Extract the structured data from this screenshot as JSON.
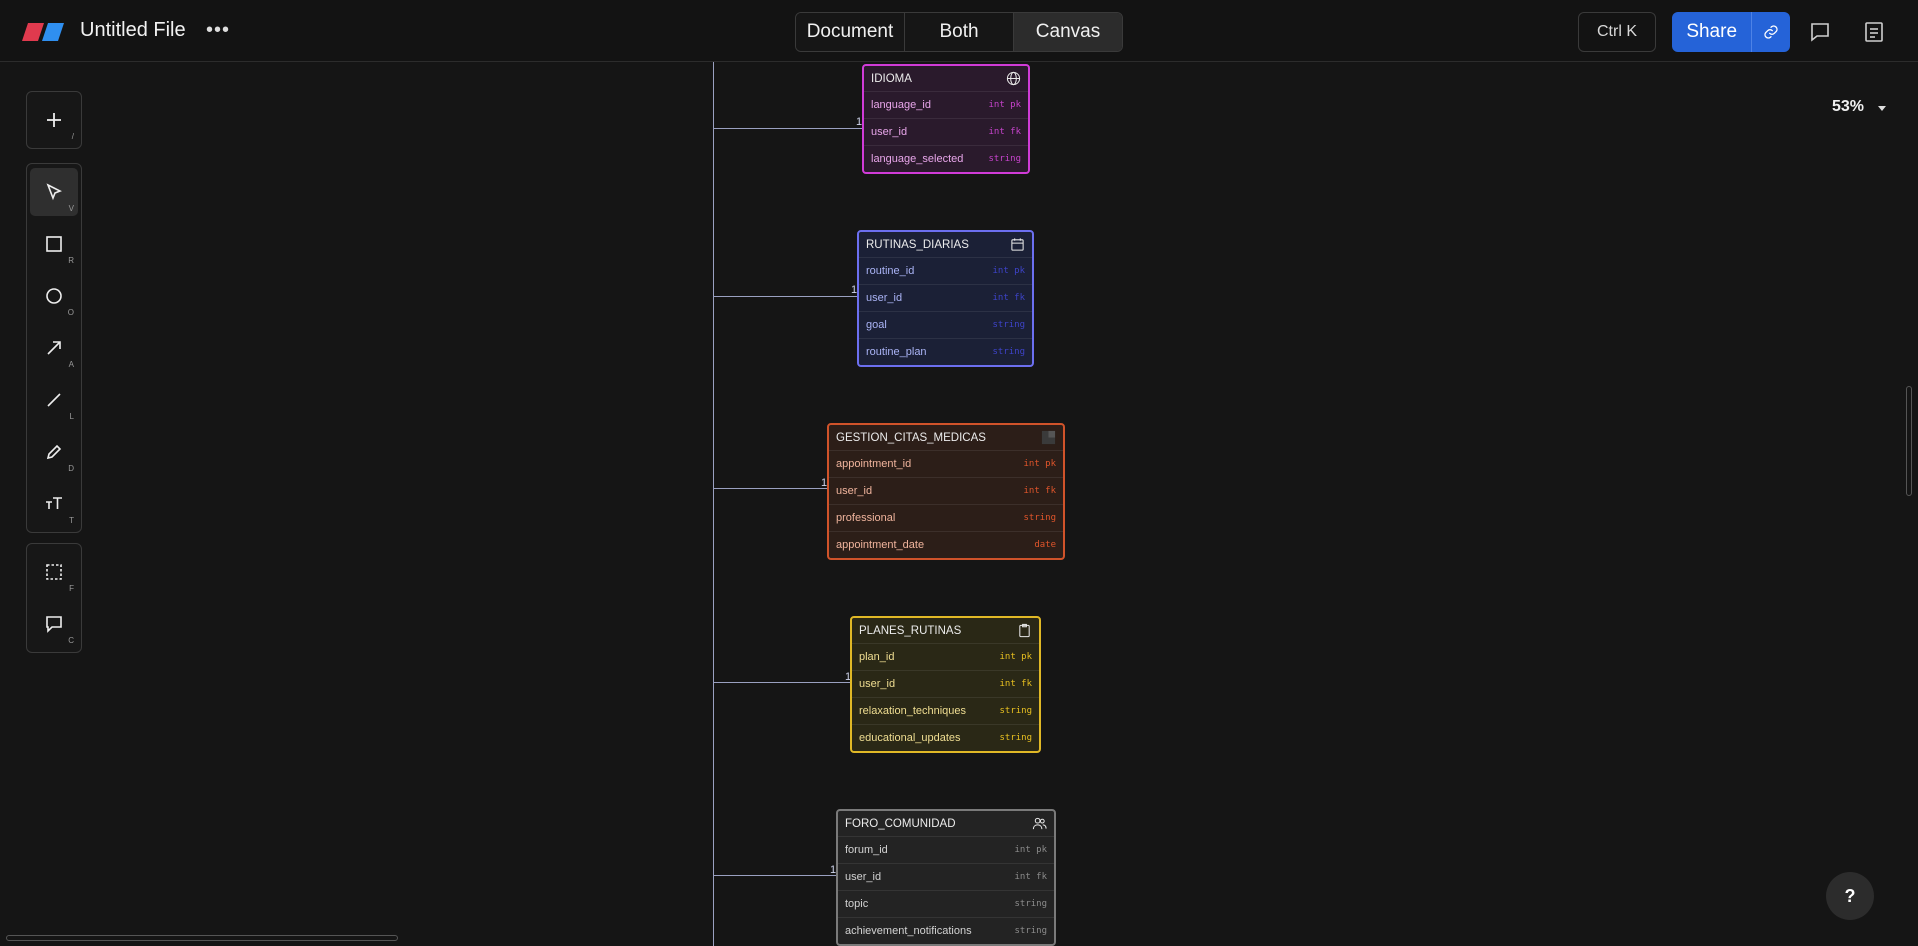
{
  "header": {
    "file_title": "Untitled File",
    "more_label": "•••",
    "view_modes": [
      "Document",
      "Both",
      "Canvas"
    ],
    "active_view": "Canvas",
    "shortcut": "Ctrl K",
    "share_label": "Share"
  },
  "toolbar": {
    "add_key": "/",
    "tools": [
      {
        "name": "select",
        "key": "V"
      },
      {
        "name": "rectangle",
        "key": "R"
      },
      {
        "name": "ellipse",
        "key": "O"
      },
      {
        "name": "arrow",
        "key": "A"
      },
      {
        "name": "line",
        "key": "L"
      },
      {
        "name": "pencil",
        "key": "D"
      },
      {
        "name": "text",
        "key": "T"
      }
    ],
    "extra": [
      {
        "name": "frame",
        "key": "F"
      },
      {
        "name": "comment",
        "key": "C"
      }
    ]
  },
  "canvas": {
    "zoom": "53%",
    "cardinality": "1",
    "entities": [
      {
        "name": "IDIOMA",
        "icon": "globe-icon",
        "color": "#d13bd8",
        "fields": [
          {
            "name": "language_id",
            "type": "int pk"
          },
          {
            "name": "user_id",
            "type": "int fk"
          },
          {
            "name": "language_selected",
            "type": "string"
          }
        ]
      },
      {
        "name": "RUTINAS_DIARIAS",
        "icon": "calendar-icon",
        "color": "#6c6ff0",
        "fields": [
          {
            "name": "routine_id",
            "type": "int pk"
          },
          {
            "name": "user_id",
            "type": "int fk"
          },
          {
            "name": "goal",
            "type": "string"
          },
          {
            "name": "routine_plan",
            "type": "string"
          }
        ]
      },
      {
        "name": "GESTION_CITAS_MEDICAS",
        "icon": "square-icon",
        "color": "#d0532a",
        "fields": [
          {
            "name": "appointment_id",
            "type": "int pk"
          },
          {
            "name": "user_id",
            "type": "int fk"
          },
          {
            "name": "professional",
            "type": "string"
          },
          {
            "name": "appointment_date",
            "type": "date"
          }
        ]
      },
      {
        "name": "PLANES_RUTINAS",
        "icon": "clipboard-icon",
        "color": "#e0b826",
        "fields": [
          {
            "name": "plan_id",
            "type": "int pk"
          },
          {
            "name": "user_id",
            "type": "int fk"
          },
          {
            "name": "relaxation_techniques",
            "type": "string"
          },
          {
            "name": "educational_updates",
            "type": "string"
          }
        ]
      },
      {
        "name": "FORO_COMUNIDAD",
        "icon": "users-icon",
        "color": "#7a7a7a",
        "fields": [
          {
            "name": "forum_id",
            "type": "int pk"
          },
          {
            "name": "user_id",
            "type": "int fk"
          },
          {
            "name": "topic",
            "type": "string"
          },
          {
            "name": "achievement_notifications",
            "type": "string"
          }
        ]
      }
    ]
  },
  "help_label": "?"
}
